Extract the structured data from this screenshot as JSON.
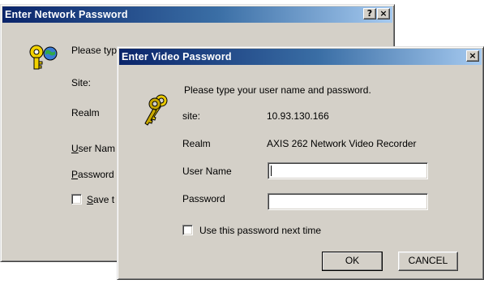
{
  "back_dialog": {
    "title": "Enter Network Password",
    "help_button": "?",
    "close_button": "×",
    "prompt": "Please typ",
    "site_label": "Site:",
    "realm_label": "Realm",
    "username_label_u": "U",
    "username_label_rest": "ser Nam",
    "password_label_p": "P",
    "password_label_rest": "assword",
    "save_label_s": "S",
    "save_label_rest": "ave t"
  },
  "front_dialog": {
    "title": "Enter Video Password",
    "close_button": "×",
    "prompt": "Please type your user name and password.",
    "site_label": "site:",
    "site_value": "10.93.130.166",
    "realm_label": "Realm",
    "realm_value": "AXIS 262 Network Video Recorder",
    "username_label": "User Name",
    "username_value": "",
    "password_label": "Password",
    "password_value": "",
    "save_password_label": "Use this password next time",
    "save_password_checked": false,
    "ok_label": "OK",
    "cancel_label": "CANCEL"
  },
  "icons": {
    "back_dialog_icon": "key-globe-icon",
    "front_dialog_icon": "keys-icon"
  }
}
